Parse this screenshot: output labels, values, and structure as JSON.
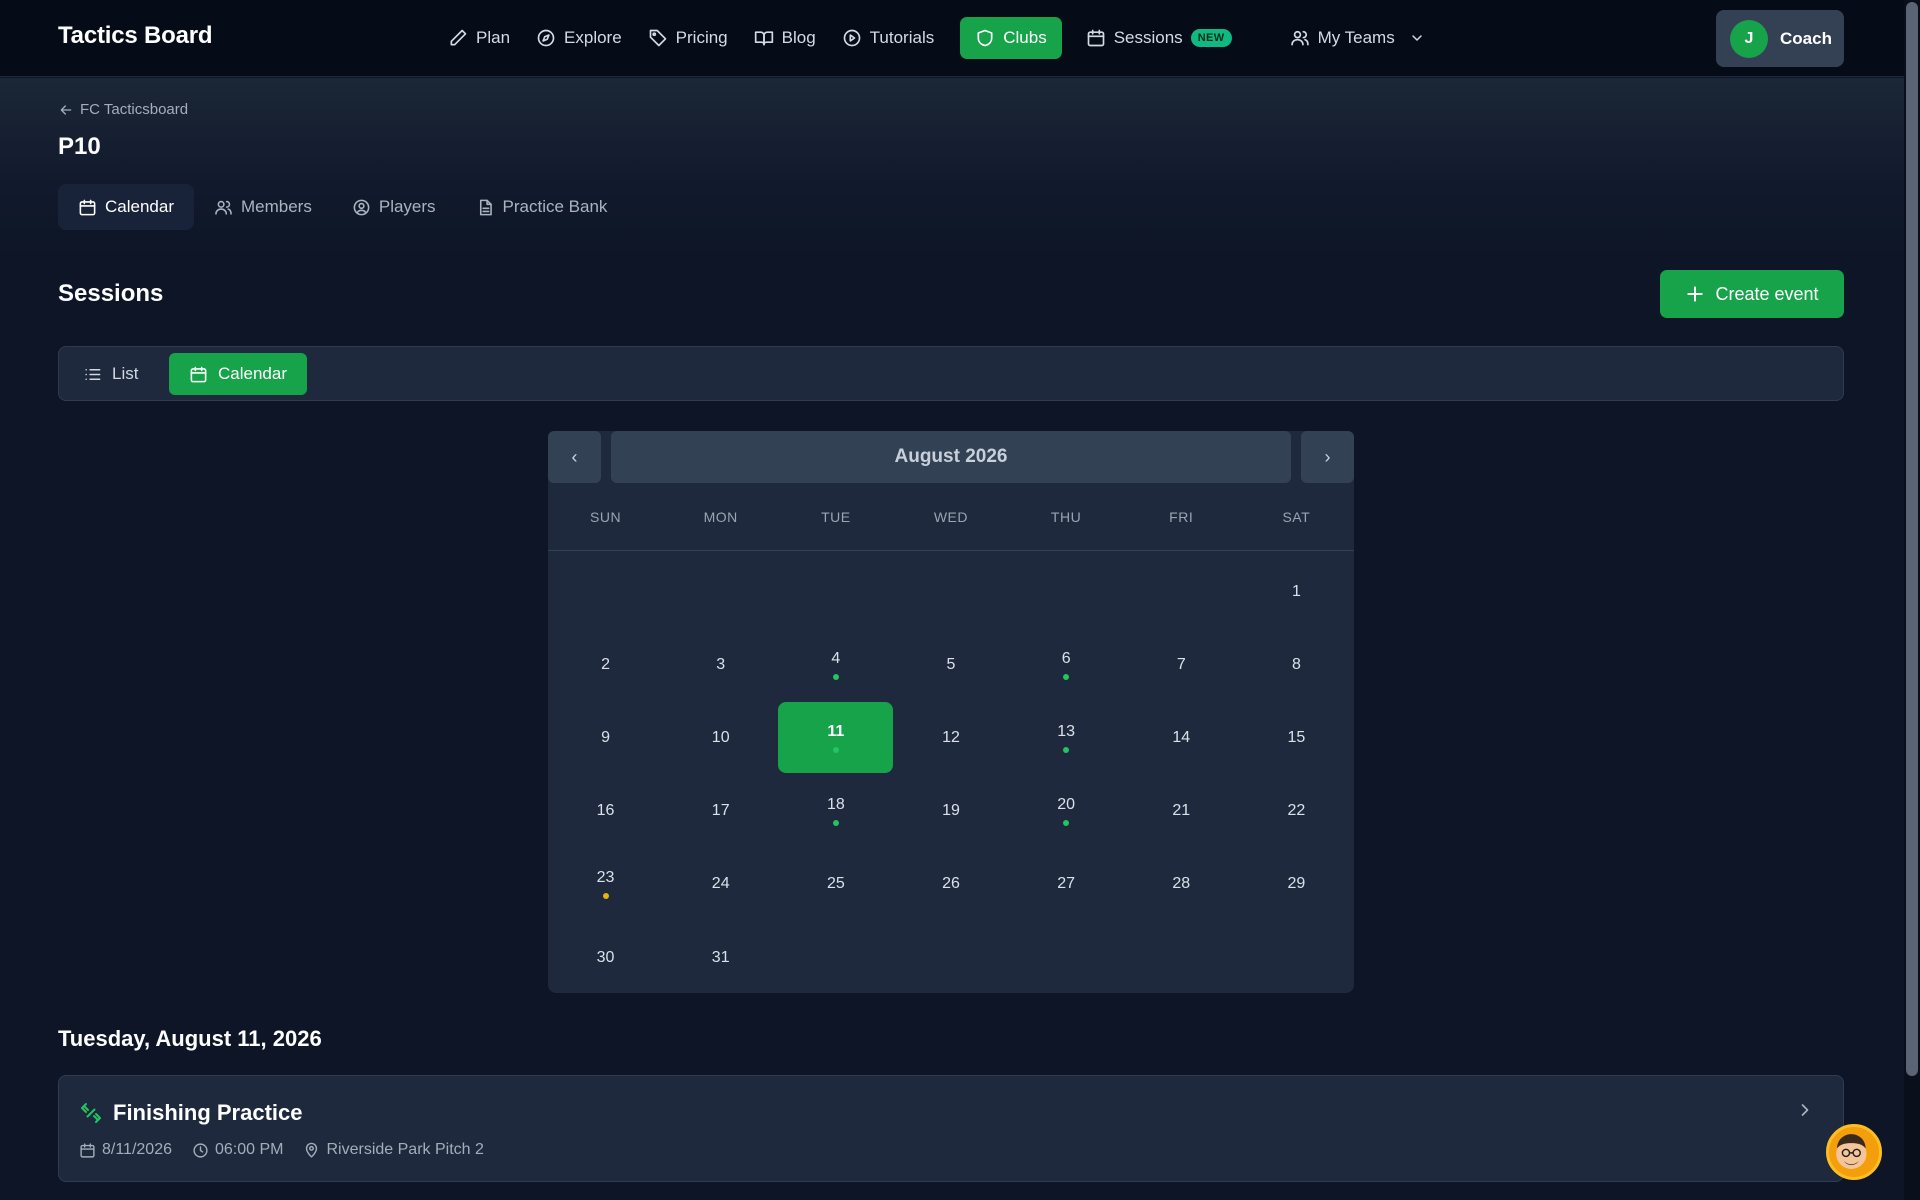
{
  "brand": "Tactics Board",
  "nav": {
    "plan": "Plan",
    "explore": "Explore",
    "pricing": "Pricing",
    "blog": "Blog",
    "tutorials": "Tutorials",
    "clubs": "Clubs",
    "sessions": "Sessions",
    "sessions_badge": "NEW",
    "my_teams": "My Teams"
  },
  "user": {
    "initial": "J",
    "label": "Coach"
  },
  "breadcrumb": {
    "back_label": "FC Tacticsboard"
  },
  "page_title": "P10",
  "tabs": {
    "calendar": "Calendar",
    "members": "Members",
    "players": "Players",
    "practice_bank": "Practice Bank"
  },
  "sessions": {
    "title": "Sessions",
    "create_label": "Create event",
    "view_list": "List",
    "view_calendar": "Calendar"
  },
  "calendar": {
    "prev": "‹",
    "next": "›",
    "month_label": "August 2026",
    "weekdays": [
      "SUN",
      "MON",
      "TUE",
      "WED",
      "THU",
      "FRI",
      "SAT"
    ],
    "first_weekday_index": 6,
    "days_in_month": 31,
    "selected_day": 11,
    "event_days": [
      {
        "day": 4,
        "color": "#22c55e"
      },
      {
        "day": 6,
        "color": "#22c55e"
      },
      {
        "day": 11,
        "color": "#22c55e"
      },
      {
        "day": 13,
        "color": "#22c55e"
      },
      {
        "day": 18,
        "color": "#22c55e"
      },
      {
        "day": 20,
        "color": "#22c55e"
      },
      {
        "day": 23,
        "color": "#eab308"
      }
    ]
  },
  "selected_date_label": "Tuesday, August 11, 2026",
  "event": {
    "title": "Finishing Practice",
    "date": "8/11/2026",
    "time": "06:00 PM",
    "location": "Riverside Park Pitch 2"
  },
  "colors": {
    "accent": "#16a34a",
    "event_dot": "#22c55e",
    "pending_dot": "#eab308"
  }
}
